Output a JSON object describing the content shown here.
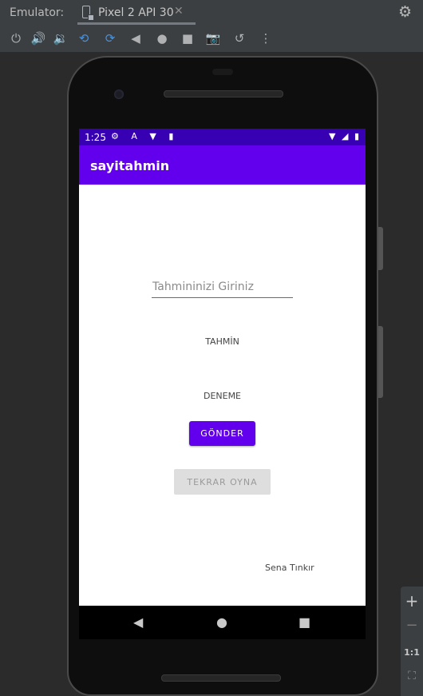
{
  "ide": {
    "emulator_label": "Emulator:",
    "device_tab": "Pixel 2 API 30",
    "tab_close": "✕",
    "settings_icon": "⚙",
    "toolbar_icons": [
      "⏻",
      "🔊",
      "🔉",
      "⟲",
      "⟳",
      "◀",
      "●",
      "■",
      "📷",
      "↺",
      "⋮"
    ]
  },
  "status_bar": {
    "time": "1:25",
    "notification_icons": "⚙ A ▼ ▮",
    "system_icons": "▼ ◢ ▮"
  },
  "app_bar": {
    "title": "sayitahmin"
  },
  "form": {
    "guess_input_placeholder": "Tahmininizi Giriniz",
    "guess_input_value": "",
    "hint_text": "TAHMİN",
    "attempts_text": "DENEME",
    "submit_label": "GÖNDER",
    "replay_label": "TEKRAR OYNA"
  },
  "author": "Sena Tınkır",
  "nav_bar": {
    "back": "◀",
    "home": "●",
    "recents": "■"
  },
  "zoom_panel": {
    "zoom_in": "+",
    "zoom_out": "−",
    "actual_size": "1:1",
    "fit": "⛶"
  },
  "colors": {
    "primary": "#6200ee",
    "primary_dark": "#3700b3",
    "disabled_button": "#dedede"
  }
}
